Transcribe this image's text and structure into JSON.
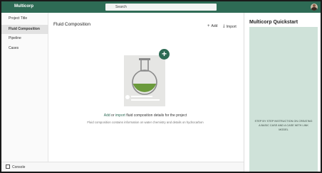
{
  "app": {
    "title": "Multicorp"
  },
  "search": {
    "placeholder": "Search"
  },
  "sidebar": {
    "items": [
      {
        "label": "Project Title",
        "active": false
      },
      {
        "label": "Fluid Composition",
        "active": true
      },
      {
        "label": "Pipeline",
        "active": false
      },
      {
        "label": "Cases",
        "active": false
      }
    ]
  },
  "main": {
    "title": "Fluid Composition",
    "toolbar": {
      "add_label": "Add",
      "import_label": "Import"
    },
    "empty_state": {
      "link_add": "Add",
      "or_text": "or",
      "link_import": "import",
      "rest_text": "fluid composition details for the project",
      "subtext": "Fluid composition contains information on water chemistry and details on hydrocarbon"
    }
  },
  "quickstart": {
    "title": "Multicorp Quickstart",
    "body": "STEP BY STEP INSTRUCTION ON CREATING A BASIC CASE AND A CASE WITH LINK MODEL"
  },
  "console": {
    "label": "Console"
  },
  "colors": {
    "accent": "#2e6b55",
    "quickstart_bg": "#cfe2d9"
  }
}
